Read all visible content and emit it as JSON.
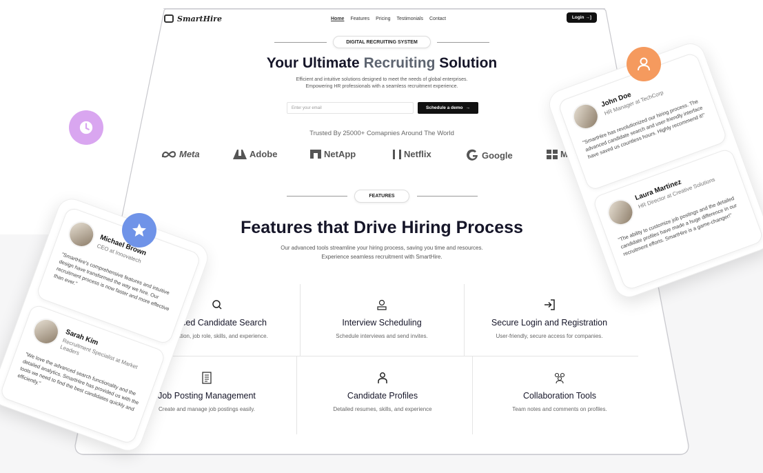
{
  "nav": {
    "logo": "SmartHire",
    "links": [
      "Home",
      "Features",
      "Pricing",
      "Testimonials",
      "Contact"
    ],
    "login": "Login"
  },
  "hero": {
    "badge": "DIGITAL RECRUITING SYSTEM",
    "title_pre": "Your Ultimate ",
    "title_accent": "Recruiting",
    "title_post": " Solution",
    "subtitle_1": "Efficient and intuitive solutions designed to meet the needs of global enterprises.",
    "subtitle_2": "Empowering HR professionals with a seamless recruitment experience.",
    "email_placeholder": "Enter your email",
    "demo_button": "Schedule a demo"
  },
  "trusted": {
    "text": "Trusted By 25000+ Comapnies Around The World",
    "brands": [
      "Meta",
      "Adobe",
      "NetApp",
      "Netflix",
      "Google",
      "Micr"
    ]
  },
  "features": {
    "badge": "FEATURES",
    "title": "Features that Drive Hiring Process",
    "subtitle_1": "Our advanced tools streamline your hiring process, saving you time and resources.",
    "subtitle_2": "Experience seamless recruitment with SmartHire.",
    "items": [
      {
        "name": "vanced Candidate Search",
        "desc": "y location, job role, skills, and experience.",
        "icon": "search-icon"
      },
      {
        "name": "Interview Scheduling",
        "desc": "Schedule interviews and send invites.",
        "icon": "interview-icon"
      },
      {
        "name": "Secure Login and Registration",
        "desc": "User-friendly, secure access for companies.",
        "icon": "login-icon"
      },
      {
        "name": "Job Posting Management",
        "desc": "Create and manage job postings easily.",
        "icon": "document-icon"
      },
      {
        "name": "Candidate Profiles",
        "desc": "Detailed resumes, skills, and experience",
        "icon": "user-icon"
      },
      {
        "name": "Collaboration Tools",
        "desc": "Team notes and comments on profiles.",
        "icon": "team-icon"
      }
    ]
  },
  "testimonials_left": [
    {
      "name": "Michael Brown",
      "role": "CEO at Innovatech",
      "quote": "\"SmartHire's comprehensive features and intuitive design have transformed the way we hire. Our recruitment process is now faster and more effective than ever.\""
    },
    {
      "name": "Sarah Kim",
      "role": "Recruitment Specialist at Market Leaders",
      "quote": "\"We love the advanced search functionality and the detailed analytics. SmartHire has provided us with the tools we need to find the best candidates quickly and efficiently.\""
    }
  ],
  "testimonials_right": [
    {
      "name": "John Doe",
      "role": "HR Manager at TechCorp",
      "quote": "\"SmartHire has revolutionized our hiring process. The advanced candidate search and user-friendly interface have saved us countless hours. Highly recommend it!\""
    },
    {
      "name": "Laura Martinez",
      "role": "HR Director at Creative Solutions",
      "quote": "\"The ability to customize job postings and the detailed candidate profiles have made a huge difference in our recruitment efforts. SmartHire is a game-changer!\""
    }
  ],
  "colors": {
    "clock_badge": "#d9a6f0",
    "star_badge": "#6f93e8",
    "user_badge": "#f59a5e",
    "accent_text": "#5d6470"
  }
}
